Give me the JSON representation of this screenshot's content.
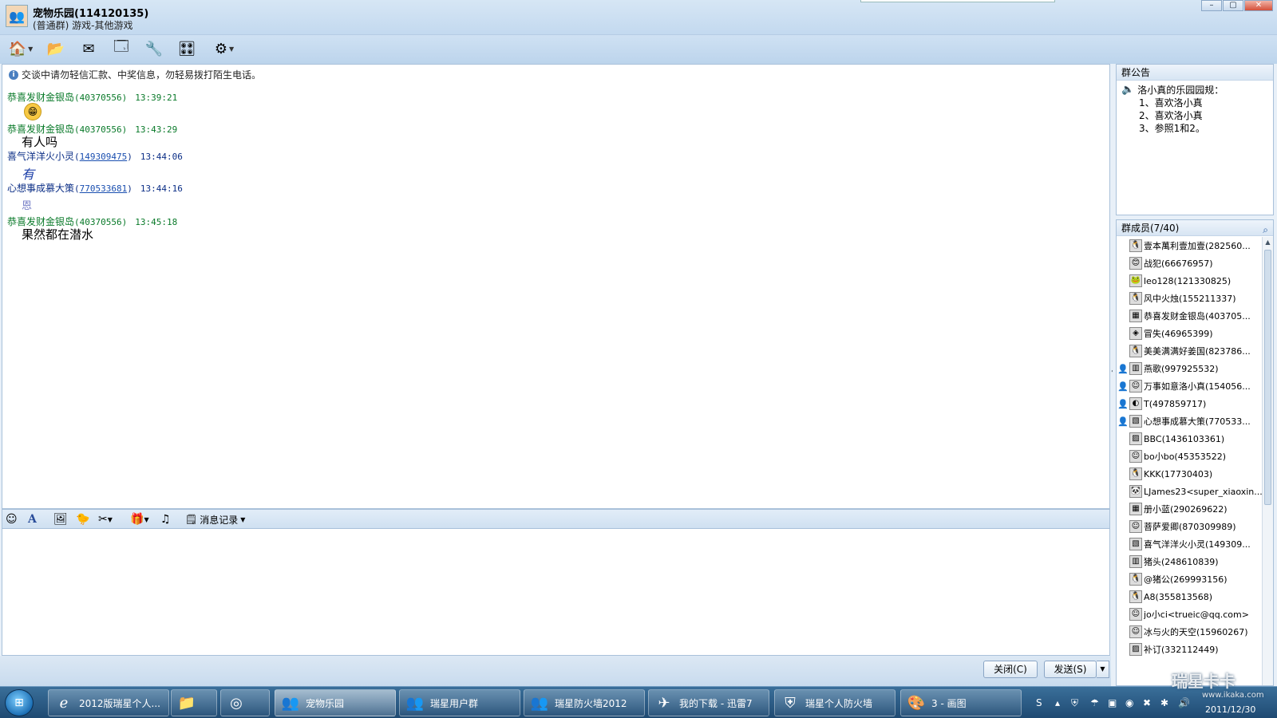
{
  "window": {
    "group_name": "宠物乐园(114120135)",
    "group_type": "(普通群) 游戏-其他游戏",
    "minimize": "–",
    "maximize": "▢",
    "close": "✕"
  },
  "toolbar": {
    "icons": [
      "home-icon",
      "folder-icon",
      "mail-icon",
      "add-app-icon",
      "tools-icon",
      "settings-icon",
      "group-settings-icon"
    ]
  },
  "chat": {
    "notice": "交谈中请勿轻信汇款、中奖信息，勿轻易拨打陌生电话。",
    "messages": [
      {
        "name": "恭喜发财金银岛",
        "qq": "(40370556)",
        "time": "13:39:21",
        "body": ""
      },
      {
        "name": "恭喜发财金银岛",
        "qq": "(40370556)",
        "time": "13:43:29",
        "body": "有人吗"
      },
      {
        "name": "喜气洋洋火小灵",
        "qq_open": "(",
        "qq": "149309475",
        "qq_close": ")",
        "time": "13:44:06",
        "body": "有"
      },
      {
        "name": "心想事成慕大策",
        "qq_open": "(",
        "qq": "770533681",
        "qq_close": ")",
        "time": "13:44:16",
        "body": "恩"
      },
      {
        "name": "恭喜发财金银岛",
        "qq": "(40370556)",
        "time": "13:45:18",
        "body": "果然都在潜水"
      }
    ]
  },
  "input_toolbar": {
    "history_label": "消息记录"
  },
  "buttons": {
    "close": "关闭(C)",
    "send": "发送(S)"
  },
  "announcement": {
    "title": "群公告",
    "lines": [
      "洛小真的乐园园规：",
      "1、喜欢洛小真",
      "2、喜欢洛小真",
      "3、参照1和2。"
    ]
  },
  "members": {
    "title": "群成员(7/40)",
    "list": [
      {
        "name": "壹本萬利壹加壹(282560...",
        "admin": false
      },
      {
        "name": "战犯(66676957)",
        "admin": false
      },
      {
        "name": "leo128(121330825)",
        "admin": false
      },
      {
        "name": "风中火烛(155211337)",
        "admin": false
      },
      {
        "name": "恭喜发财金银岛(403705...",
        "admin": false
      },
      {
        "name": "冒失(46965399)",
        "admin": false
      },
      {
        "name": "美美满满好姜国(823786...",
        "admin": false
      },
      {
        "name": "燕歌(997925532)",
        "admin": true
      },
      {
        "name": "万事如意洛小真(154056...",
        "admin": true
      },
      {
        "name": "T(497859717)",
        "admin": true
      },
      {
        "name": "心想事成慕大策(770533...",
        "admin": true
      },
      {
        "name": "BBC(1436103361)",
        "admin": false
      },
      {
        "name": "bo小bo(45353522)",
        "admin": false
      },
      {
        "name": "KKK(17730403)",
        "admin": false
      },
      {
        "name": "LJames23<super_xiaoxin...",
        "admin": false
      },
      {
        "name": "册小蓝(290269622)",
        "admin": false
      },
      {
        "name": "菩萨爱卿(870309989)",
        "admin": false
      },
      {
        "name": "喜气洋洋火小灵(149309...",
        "admin": false
      },
      {
        "name": "猪头(248610839)",
        "admin": false
      },
      {
        "name": "@猪公(269993156)",
        "admin": false
      },
      {
        "name": "A8(355813568)",
        "admin": false
      },
      {
        "name": "jo小ci<trueic@qq.com>",
        "admin": false
      },
      {
        "name": "冰与火的天空(15960267)",
        "admin": false
      },
      {
        "name": "补订(332112449)",
        "admin": false
      }
    ]
  },
  "taskbar": {
    "tasks": [
      {
        "label": "2012版瑞星个人...",
        "icon": "ie-icon"
      },
      {
        "label": "",
        "icon": "explorer-icon"
      },
      {
        "label": "",
        "icon": "media-player-icon"
      },
      {
        "label": "宠物乐园",
        "icon": "qq-group-icon"
      },
      {
        "label": "瑞星用户群",
        "icon": "qq-group-icon"
      },
      {
        "label": "瑞星防火墙2012",
        "icon": "qq-group-icon"
      },
      {
        "label": "我的下载 - 迅雷7",
        "icon": "thunder-icon"
      },
      {
        "label": "瑞星个人防火墙",
        "icon": "rising-shield-icon"
      },
      {
        "label": "3 - 画图",
        "icon": "paint-icon"
      }
    ],
    "clock_date": "2011/12/30"
  },
  "watermark": {
    "text": "瑞星卡卡",
    "url": "www.ikaka.com"
  }
}
